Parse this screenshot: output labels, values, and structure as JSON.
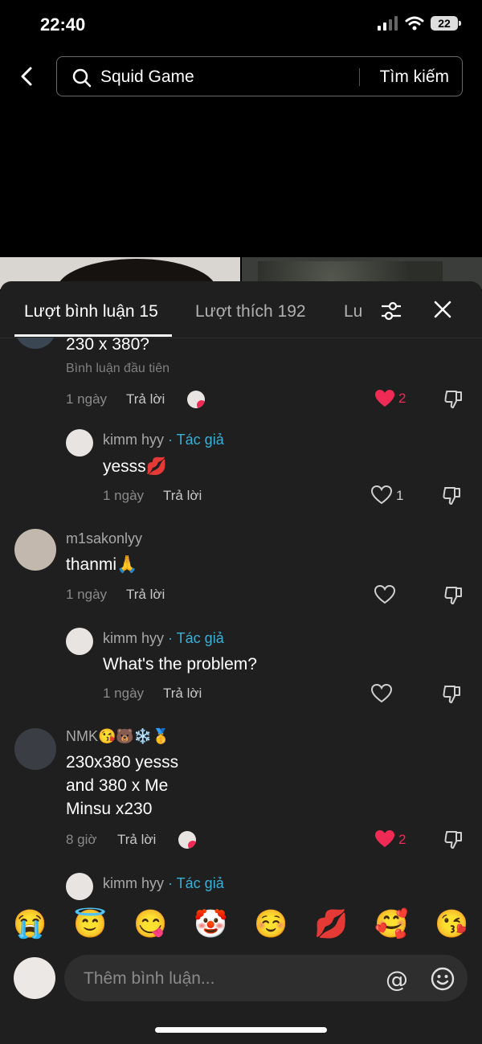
{
  "status_bar": {
    "time": "22:40",
    "battery": "22"
  },
  "search": {
    "query": "Squid Game",
    "button_label": "Tìm kiếm"
  },
  "tabs": [
    {
      "label": "Lượt bình luận 15"
    },
    {
      "label": "Lượt thích 192"
    },
    {
      "label": "Lư"
    }
  ],
  "comments": [
    {
      "text": "230 x 380?",
      "badge": "Bình luận đầu tiên",
      "time": "1 ngày",
      "reply_label": "Trả lời",
      "likes": "2",
      "liked": true
    },
    {
      "username": "kimm hyy",
      "author_tag": " · Tác giả",
      "text": "yesss💋",
      "time": "1 ngày",
      "reply_label": "Trả lời",
      "likes": "1",
      "liked": false
    },
    {
      "username": "m1sakonlyy",
      "text": "thanmi🙏",
      "time": "1 ngày",
      "reply_label": "Trả lời",
      "likes": "",
      "liked": false
    },
    {
      "username": "kimm hyy",
      "author_tag": " · Tác giả",
      "text": "What's the problem?",
      "time": "1 ngày",
      "reply_label": "Trả lời",
      "likes": "",
      "liked": false
    },
    {
      "username": "NMK😘🐻❄️🥇",
      "text_lines": [
        "230x380 yesss",
        "and 380 x Me",
        "Minsu x230"
      ],
      "time": "8 giờ",
      "reply_label": "Trả lời",
      "likes": "2",
      "liked": true
    },
    {
      "username": "kimm hyy",
      "author_tag": " · Tác giả"
    }
  ],
  "emoji_bar": [
    "😭",
    "😇",
    "😋",
    "🤡",
    "☺️",
    "💋",
    "🥰",
    "😘"
  ],
  "comment_input": {
    "placeholder": "Thêm bình luận...",
    "at_symbol": "@"
  },
  "colors": {
    "background": "#000000",
    "sheet": "#1f1f1f",
    "like_red": "#ee2a55",
    "author_blue": "#3ab0d6"
  }
}
